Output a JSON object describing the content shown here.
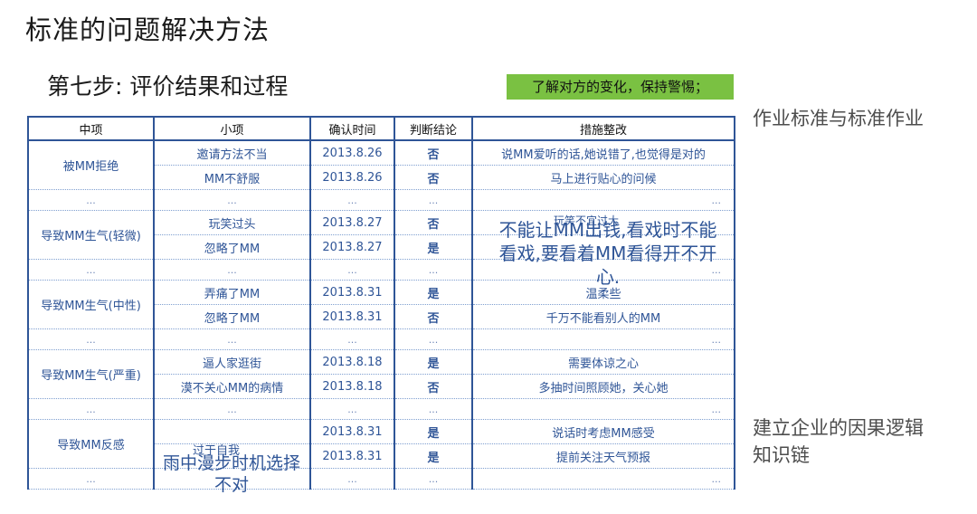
{
  "title": "标准的问题解决方法",
  "subtitle": "第七步: 评价结果和过程",
  "tag": "了解对方的变化，保持警惕；",
  "side_notes": [
    "作业标准与标准作业",
    "建立企业的因果逻辑知识链"
  ],
  "side_note2_lines": [
    "建立企业的因果逻辑",
    "知识链"
  ],
  "table": {
    "headers": [
      "中项",
      "小项",
      "确认时间",
      "判断结论",
      "措施整改"
    ],
    "ellipsis": "...",
    "groups": [
      {
        "category": "被MM拒绝",
        "rows": [
          {
            "item": "邀请方法不当",
            "date": "2013.8.26",
            "verdict": "否",
            "action": "说MM爱听的话,她说错了,也觉得是对的"
          },
          {
            "item": "MM不舒服",
            "date": "2013.8.26",
            "verdict": "否",
            "action": "马上进行贴心的问候"
          }
        ]
      },
      {
        "category": "导致MM生气(轻微)",
        "rows": [
          {
            "item": "玩笑过头",
            "date": "2013.8.27",
            "verdict": "否",
            "action": "玩笑不宜过大"
          },
          {
            "item": "忽略了MM",
            "date": "2013.8.27",
            "verdict": "是",
            "action": ""
          }
        ]
      },
      {
        "category": "导致MM生气(中性)",
        "rows": [
          {
            "item": "弄痛了MM",
            "date": "2013.8.31",
            "verdict": "是",
            "action": "温柔些"
          },
          {
            "item": "忽略了MM",
            "date": "2013.8.31",
            "verdict": "否",
            "action": "千万不能看别人的MM"
          }
        ]
      },
      {
        "category": "导致MM生气(严重)",
        "rows": [
          {
            "item": "逼人家逛街",
            "date": "2013.8.18",
            "verdict": "是",
            "action": "需要体谅之心"
          },
          {
            "item": "漠不关心MM的病情",
            "date": "2013.8.18",
            "verdict": "否",
            "action": "多抽时间照顾她，关心她"
          }
        ]
      },
      {
        "category": "导致MM反感",
        "rows": [
          {
            "item": "过于自我",
            "date": "2013.8.31",
            "verdict": "是",
            "action": "说话时考虑MM感受"
          },
          {
            "item": "",
            "date": "2013.8.31",
            "verdict": "是",
            "action": "提前关注天气预报"
          }
        ]
      }
    ]
  },
  "overlay_big_action": "不能让MM出钱,看戏时不能看戏,要看着MM看得开不开心.",
  "overlay_big_action_lines": [
    "不能让MM出钱,看戏时不能",
    "看戏,要看着MM看得开不开",
    "心."
  ],
  "overlay_item": "雨中漫步时机选择不对",
  "overlay_item_lines": [
    "雨中漫步时机选择",
    "不对"
  ]
}
